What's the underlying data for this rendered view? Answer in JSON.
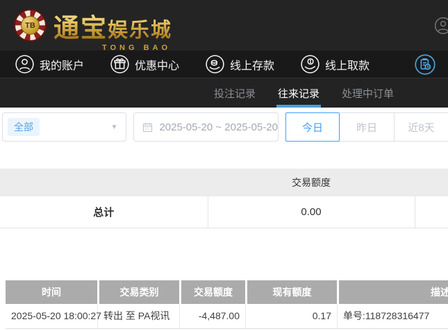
{
  "brand": {
    "chip_text": "TB",
    "name_cn_big": "通宝",
    "name_cn_small": "娱乐城",
    "name_en": "TONG BAO"
  },
  "nav": {
    "items": [
      {
        "label": "我的账户"
      },
      {
        "label": "优惠中心"
      },
      {
        "label": "线上存款"
      },
      {
        "label": "线上取款"
      }
    ]
  },
  "tabs": [
    {
      "label": "投注记录"
    },
    {
      "label": "往来记录"
    },
    {
      "label": "处理中订单"
    }
  ],
  "filters": {
    "type_selected": "全部",
    "caret": "▼",
    "date_range": "2025-05-20 ~ 2025-05-20",
    "quick_today": "今日",
    "quick_yesterday": "昨日",
    "quick_recent": "近8天"
  },
  "summary_table": {
    "amount_header": "交易额度",
    "total_label": "总计",
    "total_value": "0.00"
  },
  "records_table": {
    "headers": [
      "时间",
      "交易类别",
      "交易额度",
      "现有额度",
      "描述"
    ],
    "rows": [
      {
        "time": "2025-05-20 18:00:27",
        "type": "转出 至 PA视讯",
        "amount": "-4,487.00",
        "balance": "0.17",
        "note": "单号:118728316477"
      }
    ]
  },
  "colors": {
    "accent_blue": "#409eff",
    "tab_underline": "#4a9ed9",
    "records_icon_blue": "#4a9fd9",
    "gold": "#d9b45c",
    "table_header_gray": "#ababab"
  }
}
